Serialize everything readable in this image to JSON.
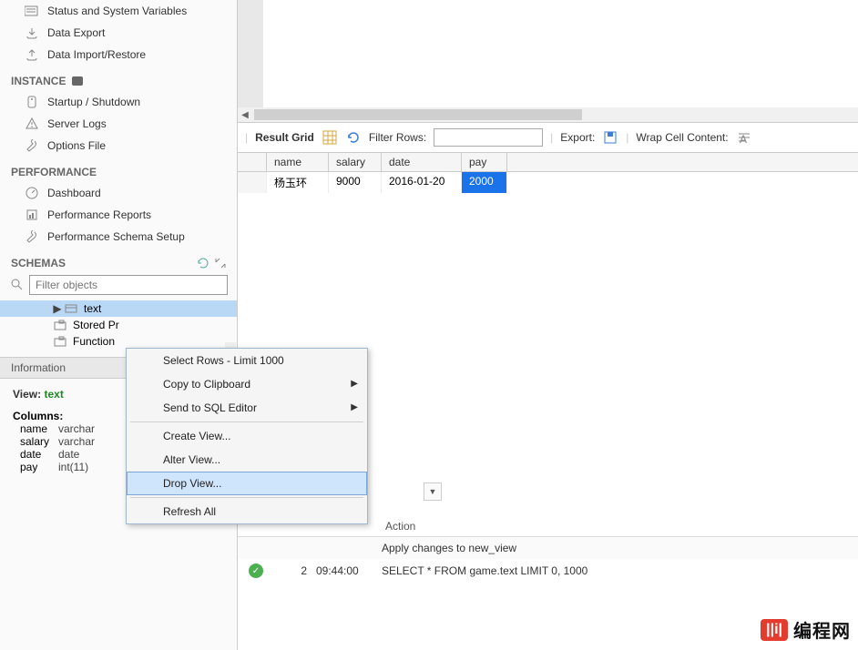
{
  "sidebar": {
    "nav1": [
      {
        "label": "Status and System Variables",
        "icon": "variables-icon"
      },
      {
        "label": "Data Export",
        "icon": "export-icon"
      },
      {
        "label": "Data Import/Restore",
        "icon": "import-icon"
      }
    ],
    "instance_label": "INSTANCE",
    "nav2": [
      {
        "label": "Startup / Shutdown",
        "icon": "server-icon"
      },
      {
        "label": "Server Logs",
        "icon": "warning-icon"
      },
      {
        "label": "Options File",
        "icon": "wrench-icon"
      }
    ],
    "performance_label": "PERFORMANCE",
    "nav3": [
      {
        "label": "Dashboard",
        "icon": "gauge-icon"
      },
      {
        "label": "Performance Reports",
        "icon": "report-icon"
      },
      {
        "label": "Performance Schema Setup",
        "icon": "wrench-icon"
      }
    ],
    "schemas_label": "SCHEMAS",
    "filter_placeholder": "Filter objects",
    "tree": [
      {
        "label": "text",
        "selected": true,
        "icon": "view-icon"
      },
      {
        "label": "Stored Pr",
        "selected": false,
        "icon": "folder-icon"
      },
      {
        "label": "Function",
        "selected": false,
        "icon": "folder-icon"
      }
    ],
    "info_label": "Information",
    "info": {
      "view_label": "View:",
      "view_name": "text",
      "columns_label": "Columns:",
      "columns": [
        {
          "name": "name",
          "type": "varchar"
        },
        {
          "name": "salary",
          "type": "varchar"
        },
        {
          "name": "date",
          "type": "date"
        },
        {
          "name": "pay",
          "type": "int(11)"
        }
      ]
    }
  },
  "toolbar": {
    "result_grid": "Result Grid",
    "filter_rows": "Filter Rows:",
    "export": "Export:",
    "wrap_cell": "Wrap Cell Content:"
  },
  "grid": {
    "headers": [
      "name",
      "salary",
      "date",
      "pay"
    ],
    "rows": [
      {
        "name": "杨玉环",
        "salary": "9000",
        "date": "2016-01-20",
        "pay": "2000"
      }
    ]
  },
  "context_menu": {
    "items": [
      {
        "label": "Select Rows - Limit 1000",
        "submenu": false
      },
      {
        "label": "Copy to Clipboard",
        "submenu": true
      },
      {
        "label": "Send to SQL Editor",
        "submenu": true
      }
    ],
    "items2": [
      {
        "label": "Create View...",
        "submenu": false
      },
      {
        "label": "Alter View...",
        "submenu": false
      },
      {
        "label": "Drop View...",
        "submenu": false,
        "hover": true
      }
    ],
    "items3": [
      {
        "label": "Refresh All",
        "submenu": false
      }
    ]
  },
  "action_log": {
    "header_action": "Action",
    "rows": [
      {
        "idx": "",
        "time": "",
        "action": "Apply changes to new_view"
      },
      {
        "idx": "2",
        "time": "09:44:00",
        "action": "SELECT * FROM game.text LIMIT 0, 1000"
      }
    ]
  },
  "watermark": {
    "badge": "||i|",
    "text": "编程网"
  }
}
